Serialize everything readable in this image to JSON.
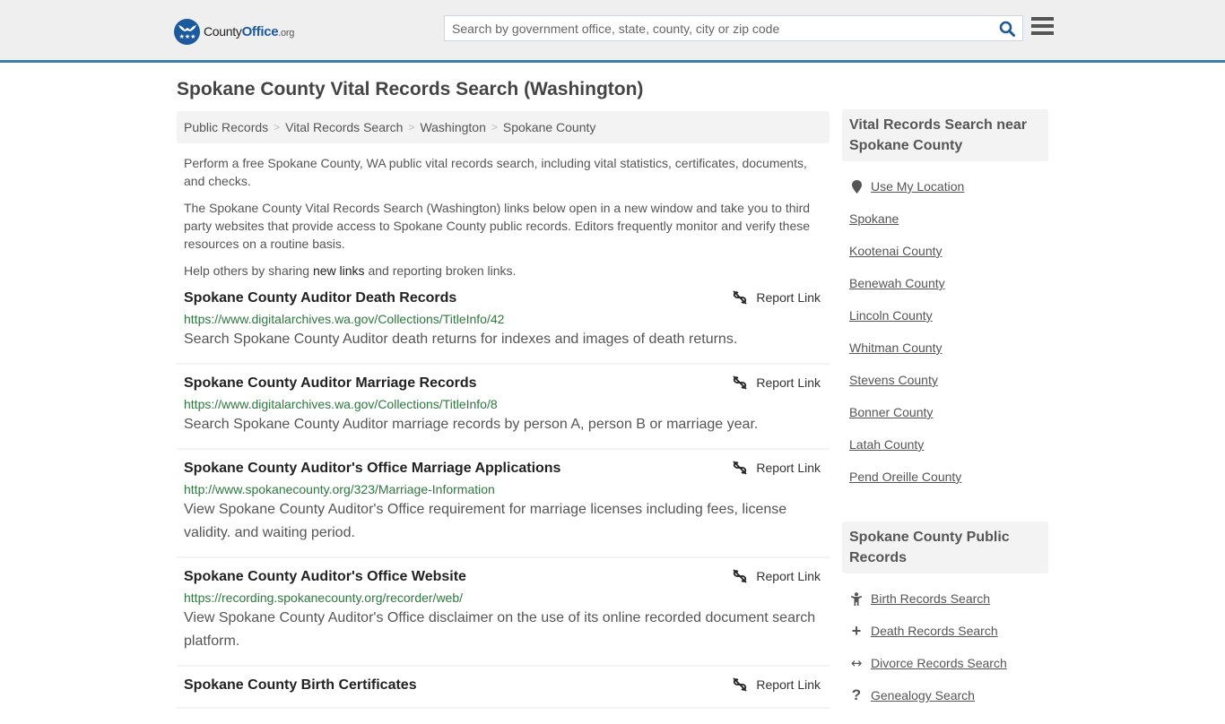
{
  "header": {
    "logo": {
      "name": "County",
      "office": "Office",
      "tld": ".org"
    },
    "search_placeholder": "Search by government office, state, county, city or zip code",
    "search_value": "",
    "accent": "#3c7dab",
    "brand": "#1c5aa0"
  },
  "page_title": "Spokane County Vital Records Search (Washington)",
  "breadcrumb": [
    "Public Records",
    "Vital Records Search",
    "Washington",
    "Spokane County"
  ],
  "intro": {
    "p1": "Perform a free Spokane County, WA public vital records search, including vital statistics, certificates, documents, and checks.",
    "p2": "The Spokane County Vital Records Search (Washington) links below open in a new window and take you to third party websites that provide access to Spokane County public records. Editors frequently monitor and verify these resources on a routine basis.",
    "p3_before": "Help others by sharing ",
    "p3_link": "new links",
    "p3_after": " and reporting broken links."
  },
  "report_label": "Report Link",
  "results": [
    {
      "title": "Spokane County Auditor Death Records",
      "url": "https://www.digitalarchives.wa.gov/Collections/TitleInfo/42",
      "desc": "Search Spokane County Auditor death returns for indexes and images of death returns."
    },
    {
      "title": "Spokane County Auditor Marriage Records",
      "url": "https://www.digitalarchives.wa.gov/Collections/TitleInfo/8",
      "desc": "Search Spokane County Auditor marriage records by person A, person B or marriage year."
    },
    {
      "title": "Spokane County Auditor's Office Marriage Applications",
      "url": "http://www.spokanecounty.org/323/Marriage-Information",
      "desc": "View Spokane County Auditor's Office requirement for marriage licenses including fees, license validity. and waiting period."
    },
    {
      "title": "Spokane County Auditor's Office Website",
      "url": "https://recording.spokanecounty.org/recorder/web/",
      "desc": "View Spokane County Auditor's Office disclaimer on the use of its online recorded document search platform."
    },
    {
      "title": "Spokane County Birth Certificates",
      "url": "",
      "desc": ""
    }
  ],
  "sidebar": {
    "nearby": {
      "heading": "Vital Records Search near Spokane County",
      "use_location": "Use My Location",
      "items": [
        "Spokane",
        "Kootenai County",
        "Benewah County",
        "Lincoln County",
        "Whitman County",
        "Stevens County",
        "Bonner County",
        "Latah County",
        "Pend Oreille County"
      ]
    },
    "public_records": {
      "heading": "Spokane County Public Records",
      "items": [
        {
          "label": "Birth Records Search",
          "icon": "child-icon",
          "glyph": ""
        },
        {
          "label": "Death Records Search",
          "icon": "plus-icon",
          "glyph": "+"
        },
        {
          "label": "Divorce Records Search",
          "icon": "arrows-horizontal-icon",
          "glyph": "↔"
        },
        {
          "label": "Genealogy Search",
          "icon": "question-icon",
          "glyph": "?"
        }
      ]
    }
  }
}
